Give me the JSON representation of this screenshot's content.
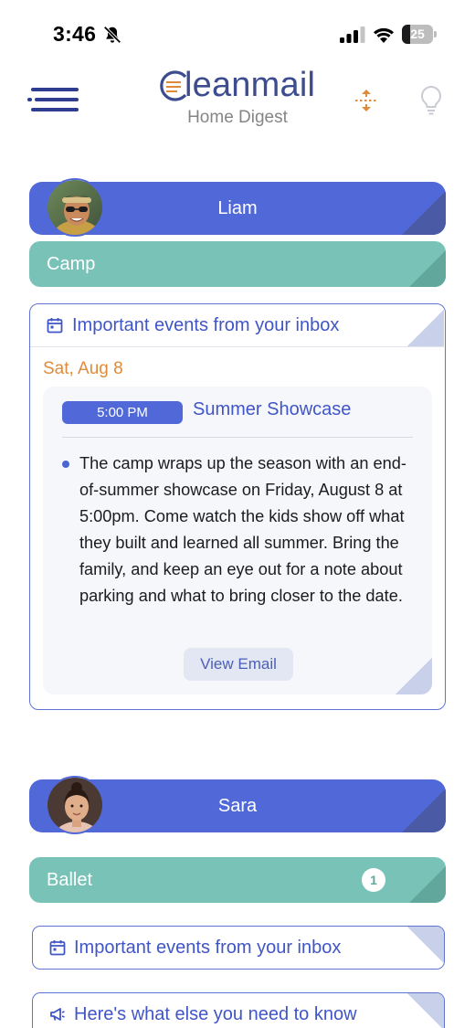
{
  "status_bar": {
    "time": "3:46",
    "battery": "25",
    "battery_level": 0.25
  },
  "header": {
    "app_name": "Cleanmail",
    "app_name_rest": "leanmail",
    "subtitle": "Home Digest",
    "icons": [
      "menu-icon",
      "collapse-expand-icon",
      "lightbulb-icon"
    ],
    "accent_color": "#e18b3a"
  },
  "people": [
    {
      "name": "Liam",
      "category": {
        "label": "Camp"
      },
      "events_card": {
        "heading": "Important events from your inbox",
        "date": "Sat, Aug 8",
        "event": {
          "time": "5:00 PM",
          "title": "Summer Showcase",
          "body": "The camp wraps up the season with an end-of-summer showcase on Friday, August 8 at 5:00pm. Come watch the kids show off what they built and learned all summer. Bring the family, and keep an eye out for a note about parking and what to bring closer to the date.",
          "button": "View Email"
        }
      }
    },
    {
      "name": "Sara",
      "category": {
        "label": "Ballet",
        "badge": "1"
      },
      "cards": [
        {
          "heading": "Important events from your inbox",
          "icon": "calendar-icon"
        },
        {
          "heading": "Here's what else you need to know",
          "icon": "megaphone-icon"
        }
      ]
    }
  ],
  "colors": {
    "person_bar": "#5169d8",
    "category_bar": "#78c2b7",
    "link_text": "#4055c7",
    "date_text": "#e18b3a"
  }
}
